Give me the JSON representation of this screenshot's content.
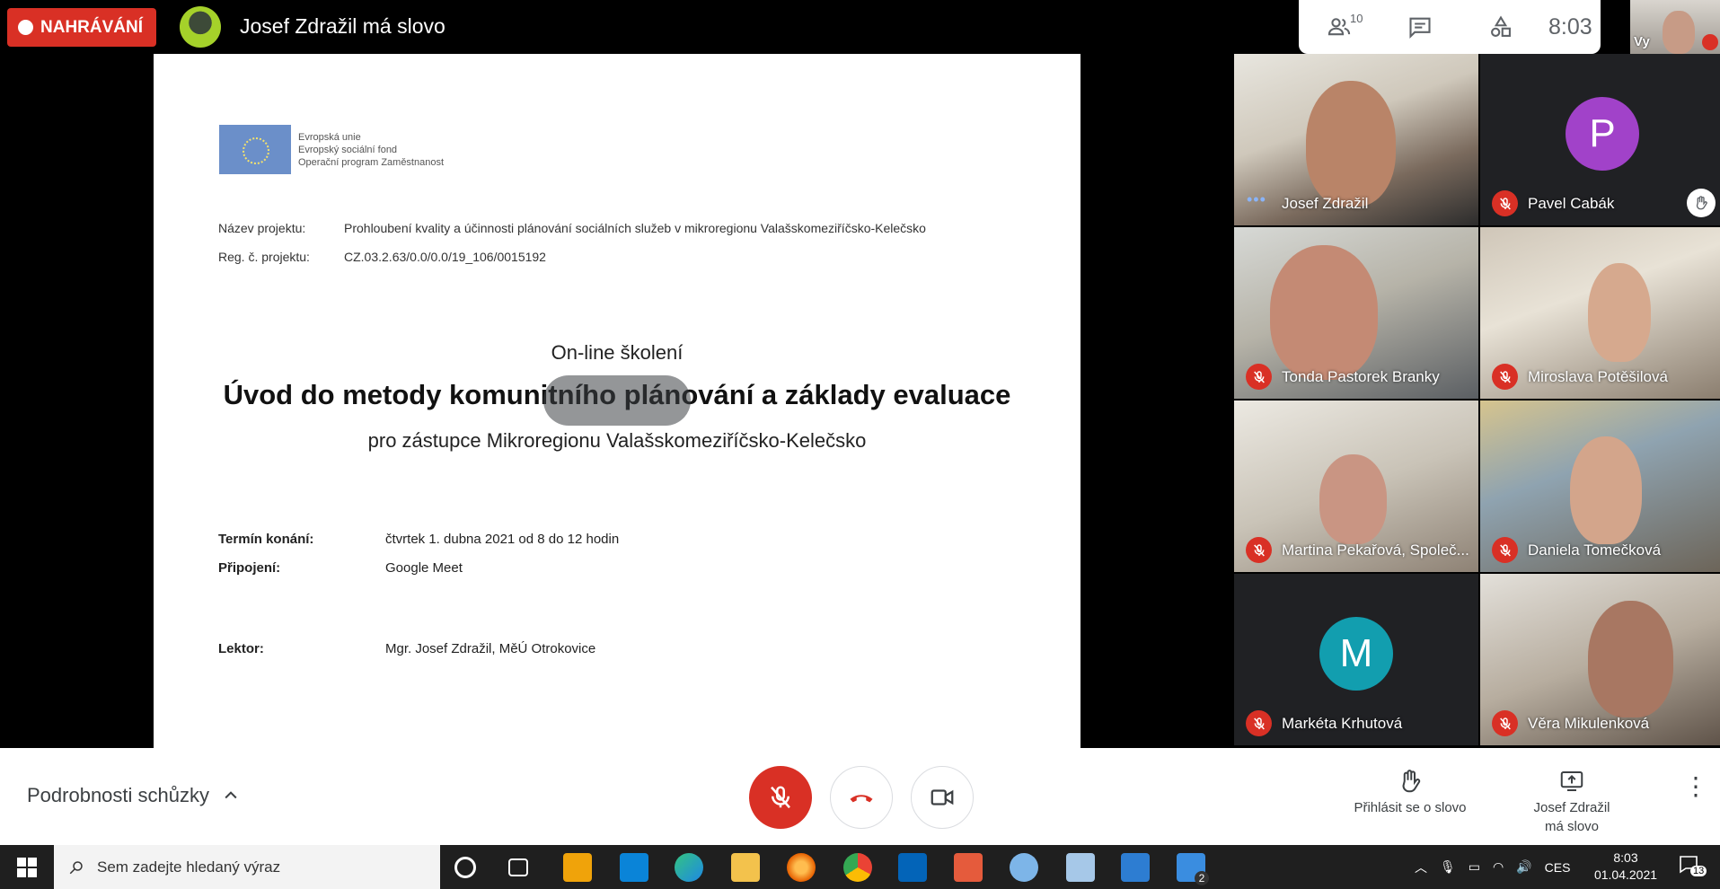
{
  "topbar": {
    "recording_label": "NAHRÁVÁNÍ",
    "speaker_title": "Josef Zdražil má slovo",
    "participants_count": "10",
    "time": "8:03",
    "self_label": "Vy"
  },
  "slide": {
    "eu_logo_lines": [
      "Evropská unie",
      "Evropský sociální fond",
      "Operační program Zaměstnanost"
    ],
    "project_name_label": "Název projektu:",
    "project_name_value": "Prohloubení kvality a účinnosti plánování sociálních služeb v mikroregionu Valašskomeziříčsko-Kelečsko",
    "reg_label": "Reg. č. projektu:",
    "reg_value": "CZ.03.2.63/0.0/0.0/19_106/0015192",
    "online_label": "On-line školení",
    "main_title": "Úvod do metody komunitního plánování a základy evaluace",
    "subtitle": "pro zástupce Mikroregionu Valašskomeziříčsko-Kelečsko",
    "date_label": "Termín konání:",
    "date_value": "čtvrtek 1. dubna 2021 od 8 do 12 hodin",
    "connection_label": "Připojení:",
    "connection_value": "Google Meet",
    "lector_label": "Lektor:",
    "lector_value": "Mgr. Josef Zdražil, MěÚ Otrokovice"
  },
  "participants": [
    {
      "name": "Josef Zdražil",
      "state": "speaking"
    },
    {
      "name": "Pavel Cabák",
      "state": "muted",
      "avatar_letter": "P",
      "avatar_color": "#a142c9",
      "hand_raised": true
    },
    {
      "name": "Tonda Pastorek Branky",
      "state": "muted"
    },
    {
      "name": "Miroslava Potěšilová",
      "state": "muted"
    },
    {
      "name": "Martina Pekařová, Společ...",
      "state": "muted"
    },
    {
      "name": "Daniela Tomečková",
      "state": "muted"
    },
    {
      "name": "Markéta Krhutová",
      "state": "muted",
      "avatar_letter": "M",
      "avatar_color": "#129eaf"
    },
    {
      "name": "Věra Mikulenková",
      "state": "muted"
    }
  ],
  "bottombar": {
    "details_label": "Podrobnosti schůzky",
    "raise_hand_label": "Přihlásit se o slovo",
    "presenting_label_1": "Josef Zdražil",
    "presenting_label_2": "má slovo"
  },
  "taskbar": {
    "search_placeholder": "Sem zadejte hledaný výraz",
    "language": "CES",
    "clock_time": "8:03",
    "clock_date": "01.04.2021",
    "notifications": "13",
    "word_badge": "2"
  },
  "colors": {
    "recording_red": "#d93025",
    "hangup_red": "#d93025",
    "meet_dark": "#202124"
  }
}
